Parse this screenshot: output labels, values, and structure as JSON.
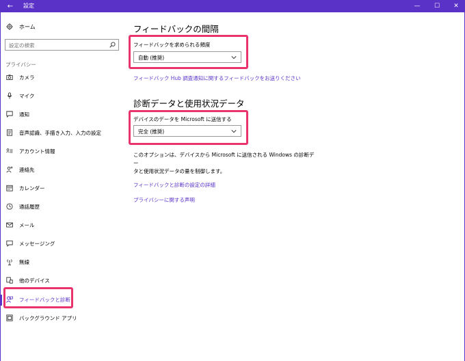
{
  "window": {
    "title": "設定",
    "back_glyph": "←",
    "minimize_glyph": "—",
    "maximize_glyph": "☐",
    "close_glyph": "✕",
    "accent_color": "#5a32c8",
    "highlight_color": "#e8336d"
  },
  "sidebar": {
    "home_label": "ホーム",
    "search_placeholder": "設定の検索",
    "section_header": "プライバシー",
    "items": [
      {
        "label": "カメラ",
        "icon": "camera-icon"
      },
      {
        "label": "マイク",
        "icon": "microphone-icon"
      },
      {
        "label": "通知",
        "icon": "notification-icon"
      },
      {
        "label": "音声認識、手描き入力、入力の設定",
        "icon": "speech-icon"
      },
      {
        "label": "アカウント情報",
        "icon": "account-info-icon"
      },
      {
        "label": "連絡先",
        "icon": "contacts-icon"
      },
      {
        "label": "カレンダー",
        "icon": "calendar-icon"
      },
      {
        "label": "通話履歴",
        "icon": "call-history-icon"
      },
      {
        "label": "メール",
        "icon": "mail-icon"
      },
      {
        "label": "メッセージング",
        "icon": "messaging-icon"
      },
      {
        "label": "無線",
        "icon": "radios-icon"
      },
      {
        "label": "他のデバイス",
        "icon": "other-devices-icon"
      },
      {
        "label": "フィードバックと診断",
        "icon": "feedback-icon",
        "active": true
      },
      {
        "label": "バックグラウンド アプリ",
        "icon": "background-apps-icon"
      }
    ]
  },
  "main": {
    "feedback_section": {
      "heading": "フィードバックの間隔",
      "label": "フィードバックを求められる頻度",
      "selected": "自動 (推奨)",
      "hub_link": "フィードバック Hub 調査通知に関するフィードバックをお送りください"
    },
    "diag_section": {
      "heading": "診断データと使用状況データ",
      "label": "デバイスのデータを Microsoft に送信する",
      "selected": "完全 (推奨)",
      "description_line1": "このオプションは、デバイスから Microsoft に送信される Windows の診断デー",
      "description_line2": "タと使用状況データの量を制御します。",
      "details_link": "フィードバックと診断の設定の詳細",
      "privacy_link": "プライバシーに関する声明"
    }
  }
}
